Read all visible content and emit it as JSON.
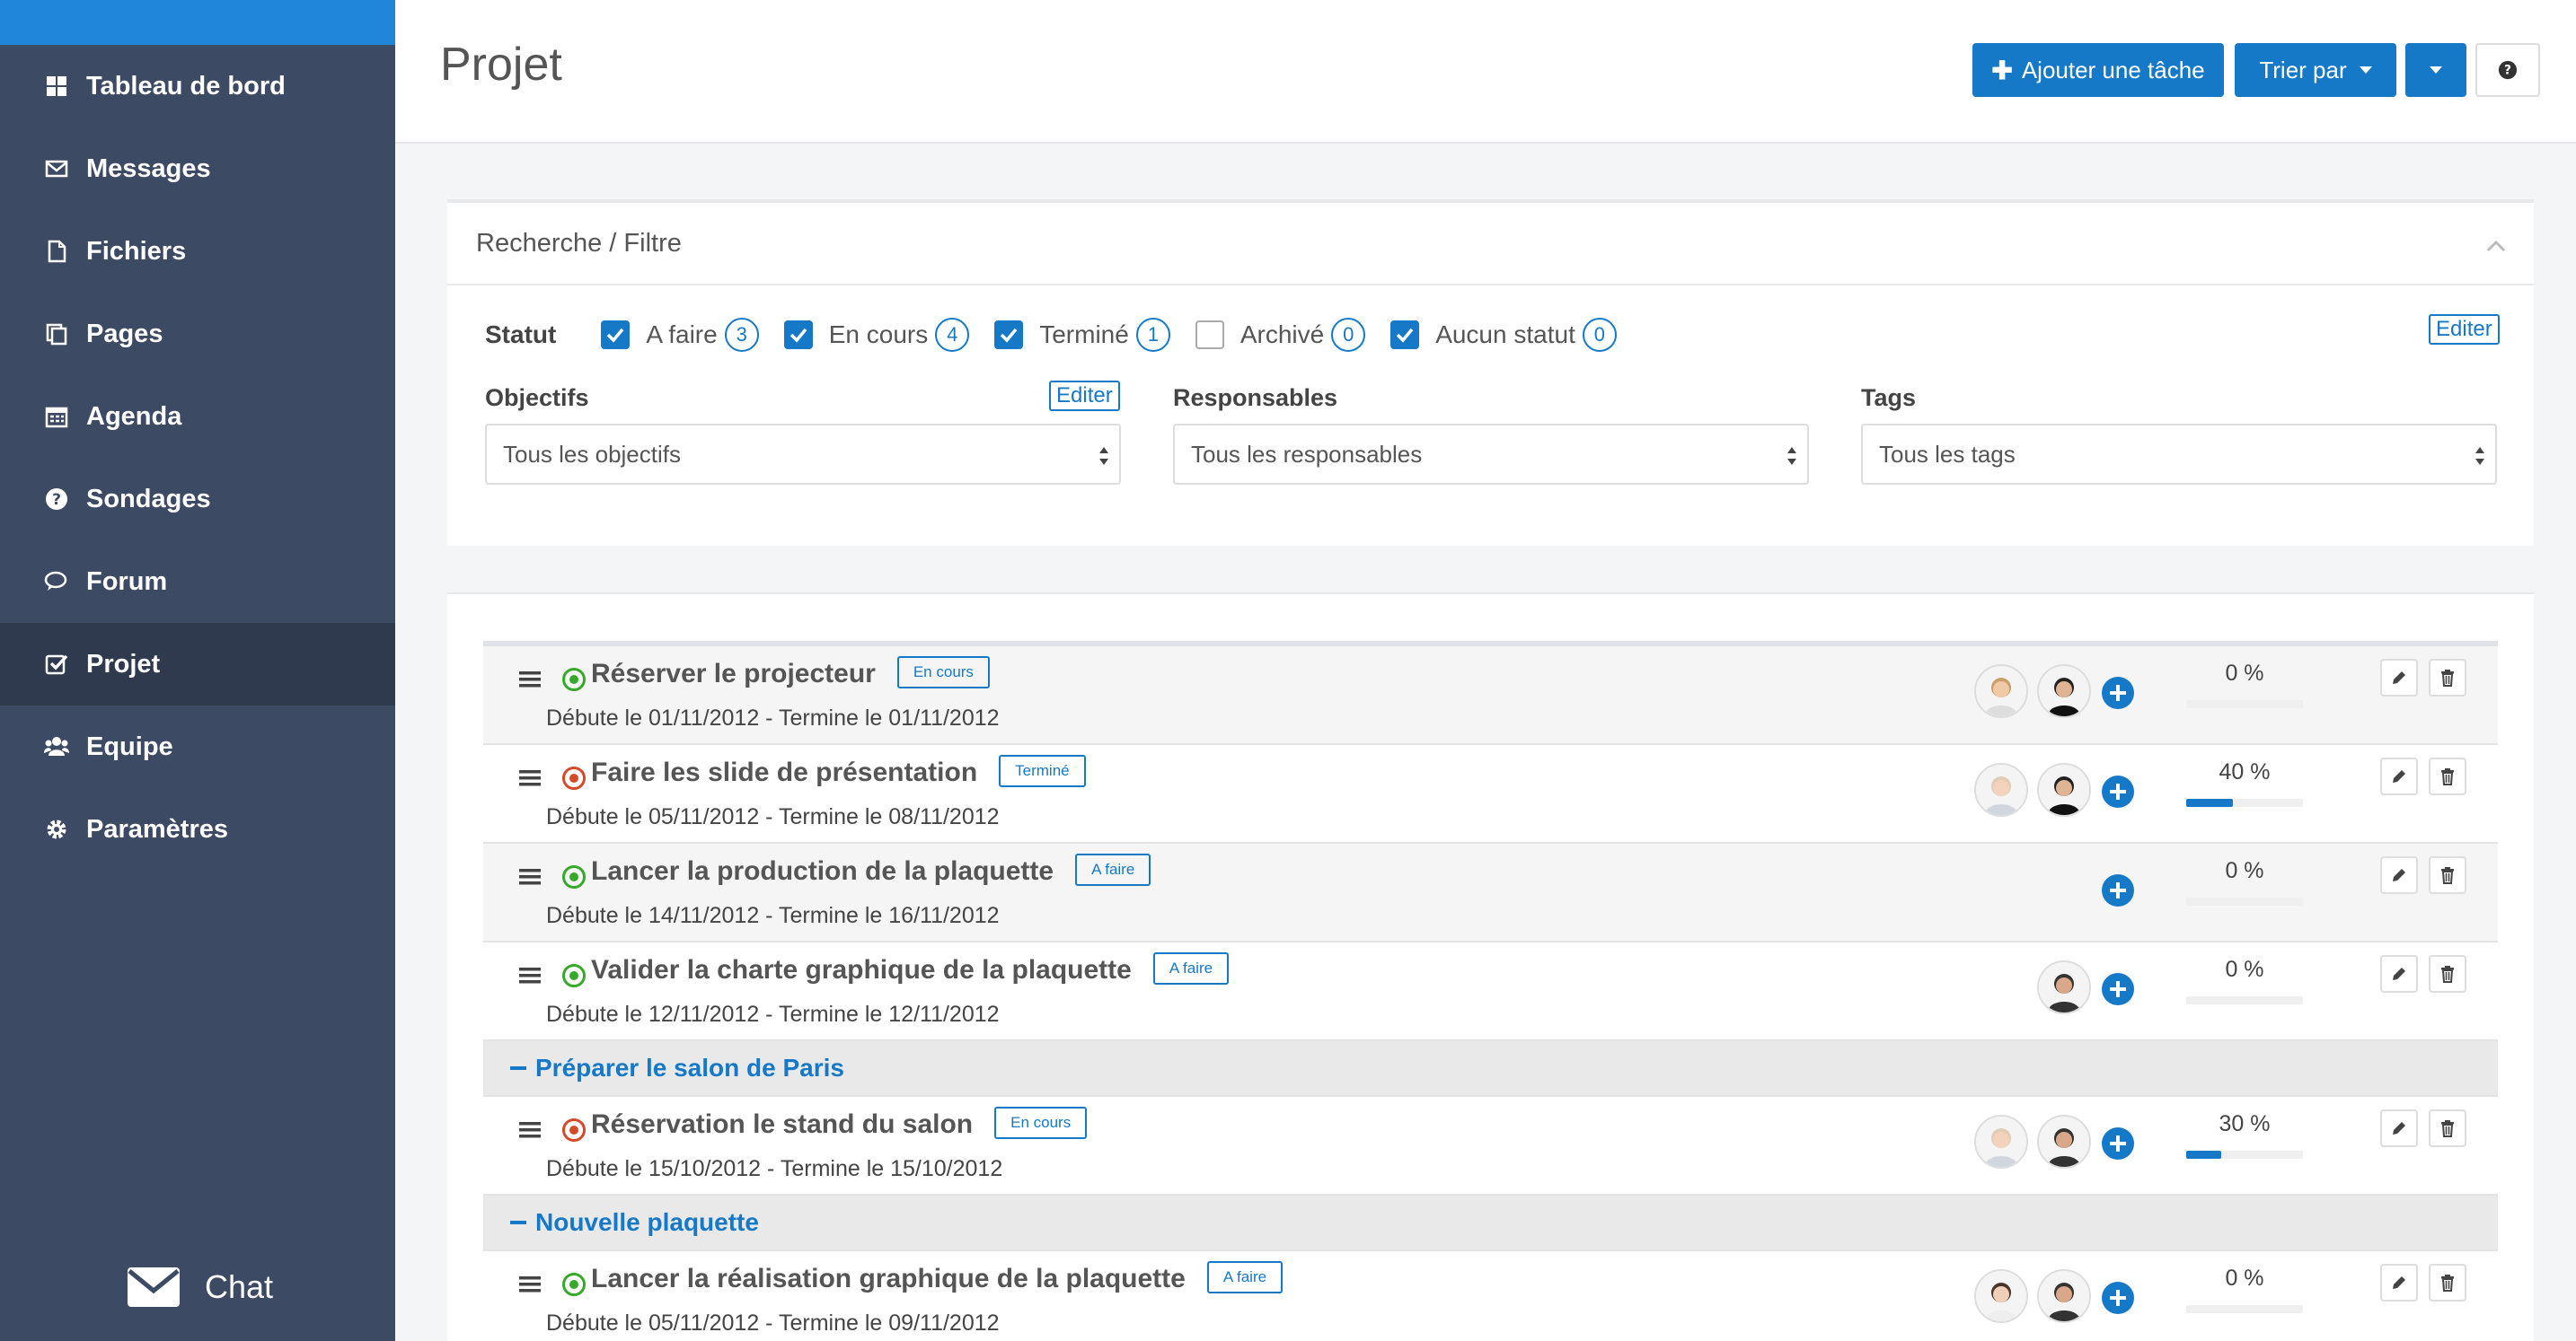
{
  "sidebar": {
    "items": [
      {
        "label": "Tableau de bord",
        "icon": "dashboard-icon",
        "active": false
      },
      {
        "label": "Messages",
        "icon": "envelope-icon",
        "active": false
      },
      {
        "label": "Fichiers",
        "icon": "file-icon",
        "active": false
      },
      {
        "label": "Pages",
        "icon": "pages-icon",
        "active": false
      },
      {
        "label": "Agenda",
        "icon": "calendar-icon",
        "active": false
      },
      {
        "label": "Sondages",
        "icon": "question-icon",
        "active": false
      },
      {
        "label": "Forum",
        "icon": "comments-icon",
        "active": false
      },
      {
        "label": "Projet",
        "icon": "check-square-icon",
        "active": true
      },
      {
        "label": "Equipe",
        "icon": "users-icon",
        "active": false
      },
      {
        "label": "Paramètres",
        "icon": "gear-icon",
        "active": false
      }
    ],
    "chat_label": "Chat"
  },
  "header": {
    "title": "Projet",
    "add_task_label": "Ajouter une tâche",
    "sort_label": "Trier par",
    "help_icon": "help-icon"
  },
  "filter": {
    "title": "Recherche / Filtre",
    "status_label": "Statut",
    "statuses": [
      {
        "label": "A faire",
        "count": "3",
        "checked": true
      },
      {
        "label": "En cours",
        "count": "4",
        "checked": true
      },
      {
        "label": "Terminé",
        "count": "1",
        "checked": true
      },
      {
        "label": "Archivé",
        "count": "0",
        "checked": false
      },
      {
        "label": "Aucun statut",
        "count": "0",
        "checked": true
      }
    ],
    "edit_label": "Editer",
    "objectives_label": "Objectifs",
    "objectives_edit": "Editer",
    "objectives_value": "Tous les objectifs",
    "responsibles_label": "Responsables",
    "responsibles_value": "Tous les responsables",
    "tags_label": "Tags",
    "tags_value": "Tous les tags"
  },
  "tasks": [
    {
      "title": "Réserver le projecteur",
      "status": "En cours",
      "state": "green",
      "dates": "Débute le 01/11/2012 - Termine le 01/11/2012",
      "avatars": [
        "woman",
        "man-dark"
      ],
      "progress": "0 %",
      "progress_value": 0
    },
    {
      "title": "Faire les slide de présentation",
      "status": "Terminé",
      "state": "red",
      "dates": "Débute le 05/11/2012 - Termine le 08/11/2012",
      "avatars": [
        "woman-light",
        "man-dark"
      ],
      "progress": "40 %",
      "progress_value": 40
    },
    {
      "title": "Lancer la production de la plaquette",
      "status": "A faire",
      "state": "green",
      "dates": "Débute le 14/11/2012 - Termine le 16/11/2012",
      "avatars": [],
      "progress": "0 %",
      "progress_value": 0
    },
    {
      "title": "Valider la charte graphique de la plaquette",
      "status": "A faire",
      "state": "green",
      "dates": "Débute le 12/11/2012 - Termine le 12/11/2012",
      "avatars": [
        "man-gray"
      ],
      "progress": "0 %",
      "progress_value": 0
    }
  ],
  "groups": [
    {
      "label": "Préparer le salon de Paris",
      "tasks": [
        {
          "title": "Réservation le stand du salon",
          "status": "En cours",
          "state": "red",
          "dates": "Débute le 15/10/2012 - Termine le 15/10/2012",
          "avatars": [
            "woman-light",
            "man-gray"
          ],
          "progress": "30 %",
          "progress_value": 30
        }
      ]
    },
    {
      "label": "Nouvelle plaquette",
      "tasks": [
        {
          "title": "Lancer la réalisation graphique de la plaquette",
          "status": "A faire",
          "state": "green",
          "dates": "Débute le 05/11/2012 - Termine le 09/11/2012",
          "avatars": [
            "woman-dark",
            "man-gray"
          ],
          "progress": "0 %",
          "progress_value": 0
        }
      ]
    }
  ],
  "colors": {
    "accent": "#1579c8",
    "sidebar": "#3d4a63",
    "sidebar_active": "#2f3a4e",
    "status_green": "#37a92a",
    "status_red": "#d44a29"
  }
}
